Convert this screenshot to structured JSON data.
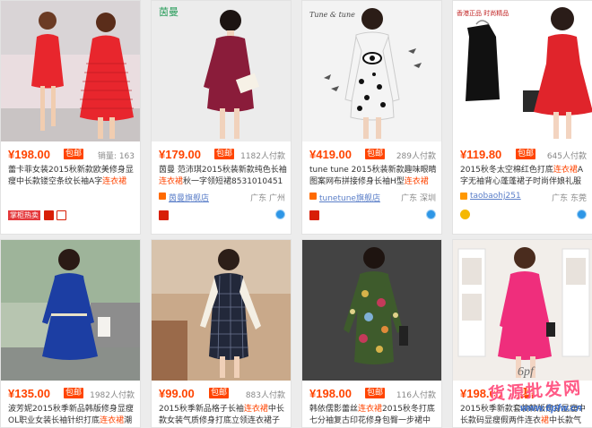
{
  "baoyou_label": "包邮",
  "products": [
    {
      "price": "¥198.00",
      "sales": "销量: 163",
      "title_pre": "蕾卡菲女装2015秋新款欧美修身显瘦中长款镂空条纹长袖A字",
      "title_hl": "连衣裙",
      "title_post": "",
      "shop": "",
      "location": "",
      "tag": "掌柜热卖",
      "bg": "#f2dde0",
      "dress": "#e8262d",
      "skin": "#f1cdb0"
    },
    {
      "price": "¥179.00",
      "sales": "1182人付款",
      "title_pre": "茵曼 范沛琪2015秋装新款纯色长袖",
      "title_hl": "连衣裙",
      "title_post": "秋一字领短裙8531010451",
      "shop": "茵曼旗舰店",
      "location": "广东 广州",
      "logo": "茵曼",
      "bg": "#ededed",
      "dress": "#8a1c3a",
      "skin": "#f1d2bc"
    },
    {
      "price": "¥419.00",
      "sales": "289人付款",
      "title_pre": "tune tune 2015秋装新款趣味眼睛图案网布拼接修身长袖H型",
      "title_hl": "连衣裙",
      "title_post": "",
      "shop": "tunetune旗舰店",
      "location": "广东 深圳",
      "logo": "Tune & tune",
      "bg": "#f4f4f4",
      "dress": "#f3f3f3",
      "skin": "#f0d2bd"
    },
    {
      "price": "¥119.80",
      "sales": "645人付款",
      "title_pre": "2015秋冬太空棉红色打底",
      "title_hl": "连衣裙",
      "title_post": "A字无袖背心蓬蓬裙子时尚伴娘礼服",
      "shop": "taobaohj251",
      "location": "广东 东莞",
      "logo": "香港正品 时尚精品",
      "bg": "#ffffff",
      "dress": "#111111",
      "skin": "#f3d4c0"
    },
    {
      "price": "¥135.00",
      "sales": "1982人付款",
      "title_pre": "波芳妮2015秋季新品韩版修身显瘦OL职业女装长袖针织打底",
      "title_hl": "连衣裙",
      "title_post": "潮",
      "bg": "#b7c5b0",
      "dress": "#1c3ea3",
      "skin": "#f1cfb5"
    },
    {
      "price": "¥99.00",
      "sales": "883人付款",
      "title_pre": "2015秋季新品格子长袖",
      "title_hl": "连衣裙",
      "title_post": "中长款女装气质修身打底立领连衣裙子",
      "bg": "#c9a98a",
      "dress": "#22283a",
      "skin": "#f0d0b8"
    },
    {
      "price": "¥198.00",
      "sales": "116人付款",
      "title_pre": "韩依儒影蕾丝",
      "title_hl": "连衣裙",
      "title_post": "2015秋冬打底七分袖复古印花修身包臀一步裙中",
      "bg": "#4a4a4a",
      "dress": "#3e5b2c",
      "skin": "#f1cfb8"
    },
    {
      "price": "¥198.00",
      "sales": "",
      "title_pre": "2015秋季新款套装韩版修身显瘦中长款码显瘦假两件连衣",
      "title_hl": "裙",
      "title_post": "中长款气质",
      "bg": "#f2eeea",
      "dress": "#ef2e7c",
      "skin": "#f3d5c3"
    }
  ],
  "watermark": {
    "line1": "货源批发网",
    "line2": "www.6pfw.cn",
    "logo": "6pf"
  }
}
